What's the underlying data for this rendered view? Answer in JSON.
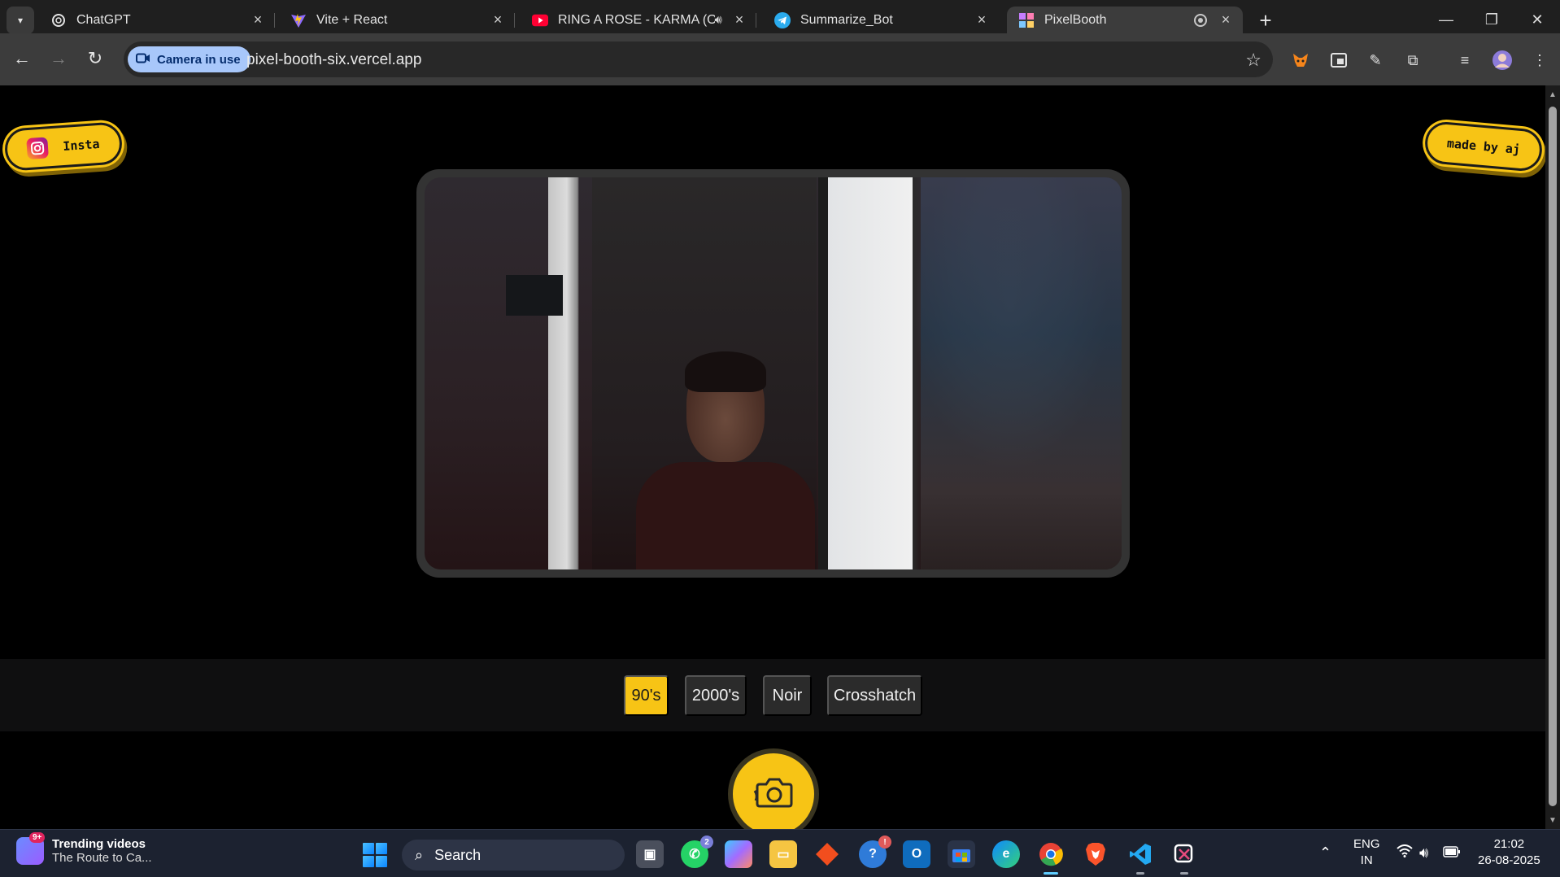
{
  "browser": {
    "tabs": [
      {
        "title": "ChatGPT",
        "icon": "chatgpt-icon"
      },
      {
        "title": "Vite + React",
        "icon": "vite-icon"
      },
      {
        "title": "RING A ROSE - KARMA (Offi",
        "icon": "youtube-icon",
        "audio": "speaker-icon"
      },
      {
        "title": "Summarize_Bot",
        "icon": "telegram-icon"
      },
      {
        "title": "PixelBooth",
        "icon": "pixelbooth-icon",
        "active": true
      }
    ],
    "camera_chip": "Camera in use",
    "url": "pixel-booth-six.vercel.app"
  },
  "page": {
    "insta_label": "Insta",
    "madeby_label": "made by aj",
    "filters": [
      {
        "label": "90's",
        "selected": true
      },
      {
        "label": "2000's",
        "selected": false
      },
      {
        "label": "Noir",
        "selected": false
      },
      {
        "label": "Crosshatch",
        "selected": false
      }
    ],
    "accent": "#f7c415"
  },
  "taskbar": {
    "widget_title": "Trending videos",
    "widget_subtitle": "The Route to Ca...",
    "widget_badge": "9+",
    "search_label": "Search",
    "whatsapp_badge": "2",
    "help_badge": "!",
    "lang_line1": "ENG",
    "lang_line2": "IN",
    "time": "21:02",
    "date": "26-08-2025"
  }
}
